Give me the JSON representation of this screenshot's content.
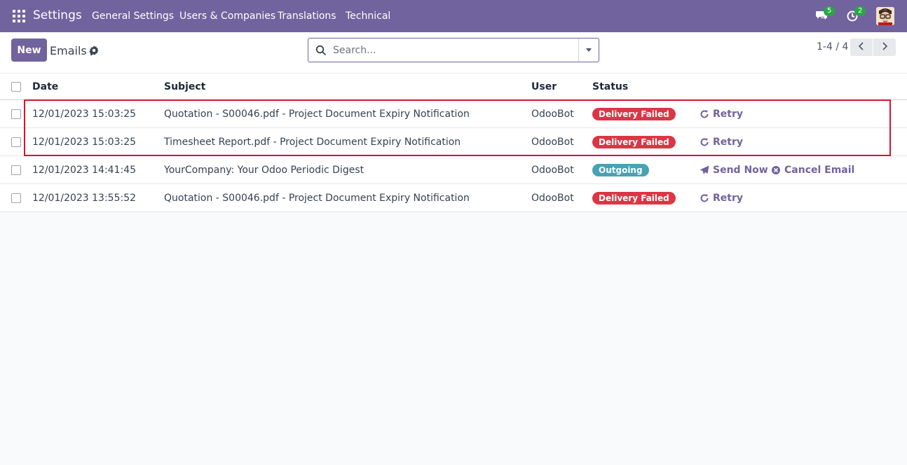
{
  "navbar": {
    "app_name": "Settings",
    "menu": [
      "General Settings",
      "Users & Companies",
      "Translations",
      "Technical"
    ],
    "messages_count": "5",
    "activities_count": "2"
  },
  "control_panel": {
    "new_label": "New",
    "title": "Emails",
    "search_placeholder": "Search...",
    "pager": "1-4 / 4"
  },
  "table": {
    "headers": {
      "date": "Date",
      "subject": "Subject",
      "user": "User",
      "status": "Status"
    },
    "rows": [
      {
        "date": "12/01/2023 15:03:25",
        "subject": "Quotation - S00046.pdf - Project Document Expiry Notification",
        "user": "OdooBot",
        "status": "Delivery Failed",
        "actions": [
          "Retry"
        ]
      },
      {
        "date": "12/01/2023 15:03:25",
        "subject": "Timesheet Report.pdf - Project Document Expiry Notification",
        "user": "OdooBot",
        "status": "Delivery Failed",
        "actions": [
          "Retry"
        ]
      },
      {
        "date": "12/01/2023 14:41:45",
        "subject": "YourCompany: Your Odoo Periodic Digest",
        "user": "OdooBot",
        "status": "Outgoing",
        "actions": [
          "Send Now",
          "Cancel Email"
        ]
      },
      {
        "date": "12/01/2023 13:55:52",
        "subject": "Quotation - S00046.pdf - Project Document Expiry Notification",
        "user": "OdooBot",
        "status": "Delivery Failed",
        "actions": [
          "Retry"
        ]
      }
    ]
  },
  "colors": {
    "brand": "#71639e",
    "failed": "#dc3545",
    "outgoing": "#48a2b4",
    "highlight": "#d3152b"
  }
}
